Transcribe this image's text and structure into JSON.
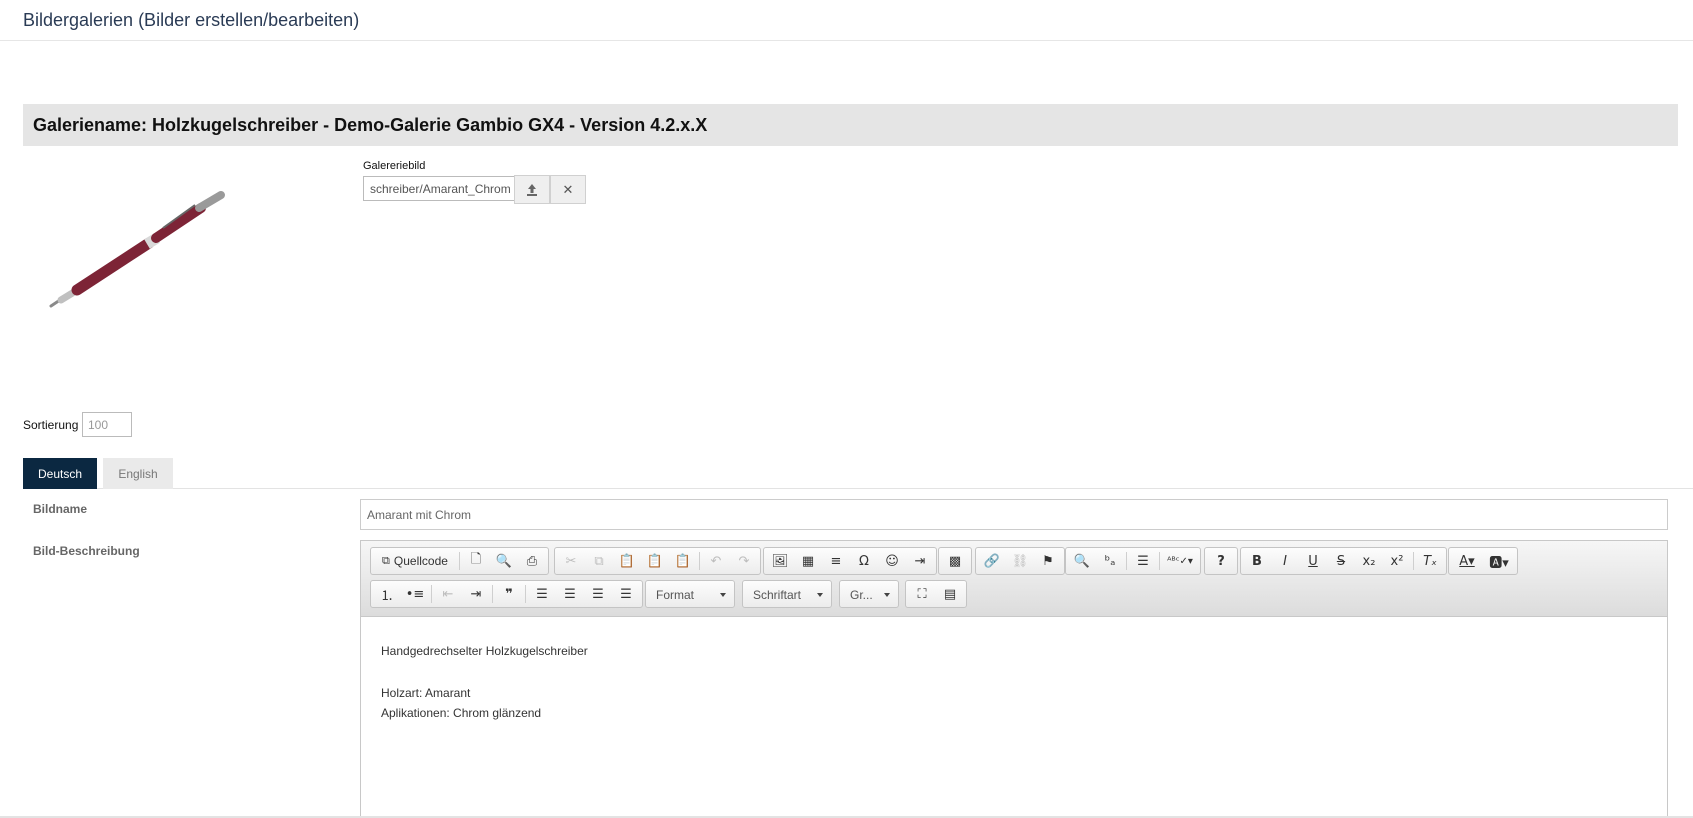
{
  "page": {
    "title": "Bildergalerien (Bilder erstellen/bearbeiten)"
  },
  "gallery": {
    "name_label": "Galeriename: Holzkugelschreiber - Demo-Galerie Gambio GX4 - Version 4.2.x.X"
  },
  "gallery_image": {
    "label": "Galereriebild",
    "value": "schreiber/Amarant_Chrom",
    "upload_icon": "upload-icon",
    "remove_icon": "close-icon"
  },
  "sort": {
    "label": "Sortierung",
    "value": "100"
  },
  "tabs": [
    {
      "label": "Deutsch",
      "active": true
    },
    {
      "label": "English",
      "active": false
    }
  ],
  "fields": {
    "bildname_label": "Bildname",
    "bildname_value": "Amarant mit Chrom",
    "beschreibung_label": "Bild-Beschreibung"
  },
  "editor": {
    "source_label": "Quellcode",
    "format_label": "Format",
    "font_label": "Schriftart",
    "size_label": "Gr...",
    "content": {
      "line1": "Handgedrechselter Holzkugelschreiber",
      "line2": "Holzart: Amarant",
      "line3": "Aplikationen: Chrom glänzend"
    }
  },
  "colors": {
    "tab_active": "#0b2841",
    "pen_wood": "#7d2436",
    "title_text": "#2a3b55"
  }
}
